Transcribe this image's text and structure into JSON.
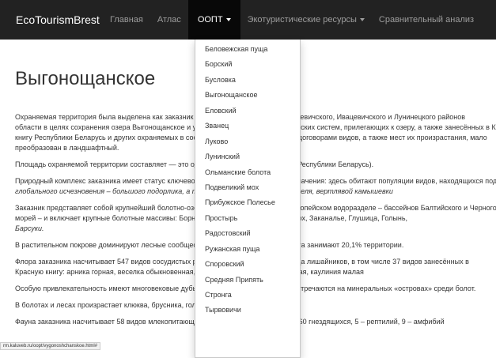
{
  "navbar": {
    "brand": "EcoTourismBrest",
    "items": [
      {
        "label": "Главная"
      },
      {
        "label": "Атлас"
      },
      {
        "label": "ООПТ"
      },
      {
        "label": "Экотуристические ресурсы"
      },
      {
        "label": "Сравнительный анализ"
      }
    ]
  },
  "dropdown": {
    "items": [
      "Беловежская пуща",
      "Борский",
      "Бусловка",
      "Выгонощанское",
      "Еловский",
      "Званец",
      "Луково",
      "Лунинский",
      "Ольманские болота",
      "Подвеликий мох",
      "Прибужское Полесье",
      "Простырь",
      "Радостовский",
      "Ружанская пуща",
      "Споровский",
      "Средняя Припять",
      "Стронга",
      "Тырвовичи"
    ]
  },
  "page": {
    "title": "Выгонощанское",
    "paragraphs": [
      "Охраняемая территория была выделена как заказник в 1968 году на территории Ганцевичского, Ивацевичского и Лунинецкого районов",
      "области в целях сохранения озера Выгоно­щанское и уникальных болотных экологических систем, прилегающих к озеру, а также занесённых в Красную",
      "книгу Республики Беларусь и других охраняемых в соответствии с международными договорами видов, а также мест их произрастания, мало",
      "преобразован в ландшафтный.",
      "Площадь охраняемой территории составляет — это один из крупнейших заказников Республики Беларусь).",
      "Природный комплекс заказника имеет статус ключевого для птиц, международного значения: здесь обитают популяции видов, находящихся под угрозой",
      "глобального исчезновения – большого подорлика, а также белоглазой чернети, дупеля, вертлявой камышевки",
      "Заказник представляет собой крупнейший болотно-озёрный комплекс на главном европейском водоразделе – бассейнов Балтийского и Черного",
      "морей – и включает крупные болотные массивы: Борня, Олешня, а также урочища Мох, Заканалье, Глушица, Голынь,",
      "Барсуки.",
      "В растительном покрове доминируют лесные сообщества (площади), открытые болота занимают 20,1% территории.",
      "Флора заказника насчитывает 547 видов сосудистых растений, мохообразных, 74 вида лишайников, в том числе 37 видов занесённых в",
      "Красную книгу: арника горная, веселка обыкновенная, лук медвежий, лилия кудреватая, каулиния малая",
      "Особую привлекательность имеют многовековые дубы возрастом 600 лет, которые встречаются на минеральных «островах» среди болот.",
      "В болотах и лесах произрастает клюква, брусника, голубика.",
      "Фауна заказника насчитывает 58 видов млекопитающих, 184 вида птиц, из которых 160 гнездящихся, 5 – рептилий, 9 – амфибий"
    ]
  },
  "status_bar": "rm.kaluveb.ru/oopt/vygonoshchanskoe.html#"
}
